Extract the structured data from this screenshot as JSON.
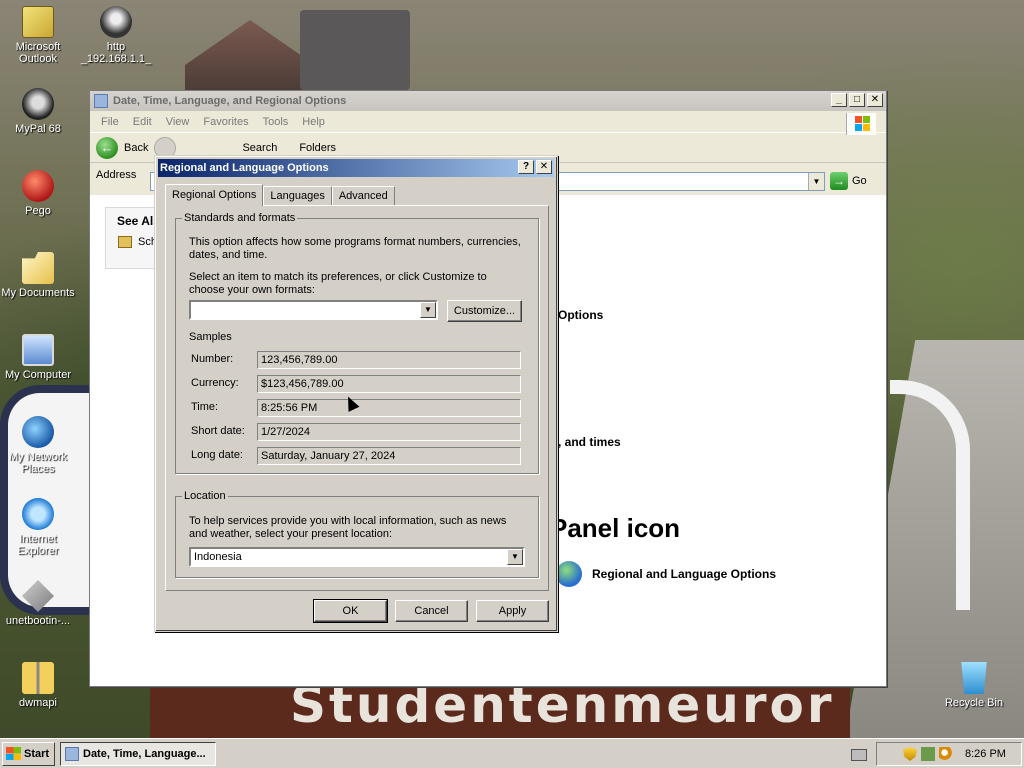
{
  "desktop": {
    "icons": [
      {
        "label": "Microsoft Outlook",
        "icon": "outlook-icon"
      },
      {
        "label": "http _192.168.1.1_",
        "icon": "http-shortcut-icon"
      },
      {
        "label": "MyPal 68",
        "icon": "mypal-icon"
      },
      {
        "label": "Pego",
        "icon": "pego-icon"
      },
      {
        "label": "My Documents",
        "icon": "my-documents-icon"
      },
      {
        "label": "My Computer",
        "icon": "my-computer-icon"
      },
      {
        "label": "My Network Places",
        "icon": "network-places-icon"
      },
      {
        "label": "Internet Explorer",
        "icon": "internet-explorer-icon"
      },
      {
        "label": "unetbootin-...",
        "icon": "unetbootin-icon"
      },
      {
        "label": "dwmapi",
        "icon": "zip-folder-icon"
      },
      {
        "label": "Recycle Bin",
        "icon": "recycle-bin-icon"
      }
    ],
    "background_sign_text": "Studentenmeuror"
  },
  "explorer": {
    "title": "Date, Time, Language, and Regional Options",
    "menu": [
      "File",
      "Edit",
      "View",
      "Favorites",
      "Tools",
      "Help"
    ],
    "toolbar": {
      "back": "Back",
      "search": "Search",
      "folders": "Folders"
    },
    "address_label": "Address",
    "go_label": "Go",
    "see_also": {
      "heading": "See Als",
      "item": "Sch"
    },
    "content": {
      "options_heading": "Options",
      "times_text": ", and times",
      "panel_heading": "Panel icon",
      "regional_link": "Regional and Language Options"
    }
  },
  "dialog": {
    "title": "Regional and Language Options",
    "help_btn": "?",
    "close_btn": "✕",
    "tabs": [
      "Regional Options",
      "Languages",
      "Advanced"
    ],
    "standards": {
      "legend": "Standards and formats",
      "desc": "This option affects how some programs format numbers, currencies, dates, and time.",
      "select_desc": "Select an item to match its preferences, or click Customize to choose your own formats:",
      "format_value": "",
      "customize": "Customize...",
      "samples_label": "Samples",
      "samples": [
        {
          "label": "Number:",
          "value": "123,456,789.00"
        },
        {
          "label": "Currency:",
          "value": "$123,456,789.00"
        },
        {
          "label": "Time:",
          "value": "8:25:56 PM"
        },
        {
          "label": "Short date:",
          "value": "1/27/2024"
        },
        {
          "label": "Long date:",
          "value": "Saturday, January 27, 2024"
        }
      ]
    },
    "location": {
      "legend": "Location",
      "desc": "To help services provide you with local information, such as news and weather, select your present location:",
      "value": "Indonesia"
    },
    "buttons": {
      "ok": "OK",
      "cancel": "Cancel",
      "apply": "Apply"
    }
  },
  "taskbar": {
    "start": "Start",
    "task": "Date, Time, Language...",
    "clock": "8:26 PM"
  }
}
